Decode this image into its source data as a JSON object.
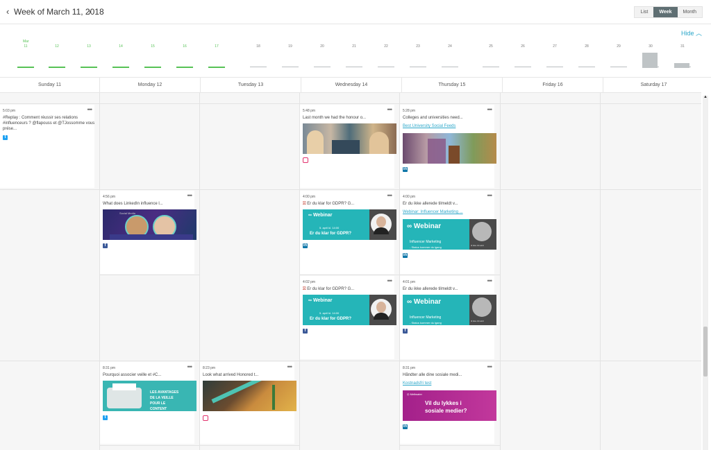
{
  "header": {
    "prev_arrow": "‹",
    "next_arrow": "›",
    "title": "Week of March 11, 2018",
    "views": [
      "List",
      "Week",
      "Month"
    ],
    "active_view": "Week"
  },
  "strip": {
    "hide_label": "Hide",
    "month_label": "Mar",
    "days": [
      "11",
      "12",
      "13",
      "14",
      "15",
      "16",
      "17",
      "18",
      "19",
      "20",
      "21",
      "22",
      "23",
      "24",
      "25",
      "26",
      "27",
      "28",
      "29",
      "30",
      "31"
    ]
  },
  "day_headers": [
    "Sunday 11",
    "Monday 12",
    "Tuesday 13",
    "Wednesday 14",
    "Thursday 15",
    "Friday 16",
    "Saturday 17"
  ],
  "posts": {
    "sun_1": {
      "time": "5:03 pm",
      "text": "#Replay : Comment réussir ses relations #influenceurs ? @flapouss et @TJossomme vous prése...",
      "network": "twitter"
    },
    "wed_1": {
      "time": "5:48 pm",
      "text": "Last month we had the honour o...",
      "network": "instagram"
    },
    "thu_1": {
      "time": "5:28 pm",
      "text": "Colleges and universities need...",
      "link": "Best University Social Feeds",
      "network": "linkedin"
    },
    "mon_2": {
      "time": "4:56 pm",
      "text": "What does LinkedIn influence l...",
      "network": "facebook",
      "thumb_tag": "Social Media"
    },
    "wed_2": {
      "time": "4:00 pm",
      "text": "Er du klar for GDPR? G...",
      "network": "linkedin",
      "thumb": {
        "title": "Webinar",
        "date": "5. april kl. 14:00",
        "headline": "Er du klar for GDPR?"
      }
    },
    "thu_2": {
      "time": "4:00 pm",
      "text": "Er du ikke allerede tilmeldt v...",
      "link": "Webinar: Influencer Marketing ...",
      "network": "linkedin",
      "thumb": {
        "title": "Webinar",
        "headline": "Influencer Marketing",
        "sub": "- Status kommer du igang",
        "badge": "til ikke tilmeldt"
      }
    },
    "wed_3": {
      "time": "4:02 pm",
      "text": "Er du klar for GDPR? G...",
      "network": "facebook",
      "thumb": {
        "title": "Webinar",
        "date": "5. april kl. 14:00",
        "headline": "Er du klar for GDPR?"
      }
    },
    "thu_3": {
      "time": "4:01 pm",
      "text": "Er du ikke allerede tilmeldt v...",
      "network": "facebook",
      "thumb": {
        "title": "Webinar",
        "headline": "Influencer Marketing",
        "sub": "- Status kommer du igang",
        "badge": "til ikke tilmeldt"
      }
    },
    "mon_4": {
      "time": "8:31 pm",
      "text": "Pourquoi associer veille et #C...",
      "network": "twitter",
      "thumb": {
        "line1": "LES AVANTAGES",
        "line2": "DE LA VEILLE",
        "line3": "POUR LE",
        "line4": "CONTENT"
      }
    },
    "tue_4": {
      "time": "8:23 pm",
      "text": "Look what arrived Honored t...",
      "network": "instagram"
    },
    "thu_4": {
      "time": "8:31 pm",
      "text": "Håndter alle dine sosiale medi...",
      "link": "Kostnadsfri test",
      "network": "linkedin",
      "thumb": {
        "brand": "Meltwater",
        "line1": "Vil du lykkes i",
        "line2": "sosiale medier?"
      }
    }
  },
  "colors": {
    "accent_green": "#56c255",
    "link_blue": "#2aa6c9",
    "webinar_teal": "#25b5b8",
    "twitter": "#1da1f2",
    "facebook": "#3b5998",
    "linkedin": "#0e76a8",
    "instagram": "#e1306c"
  }
}
